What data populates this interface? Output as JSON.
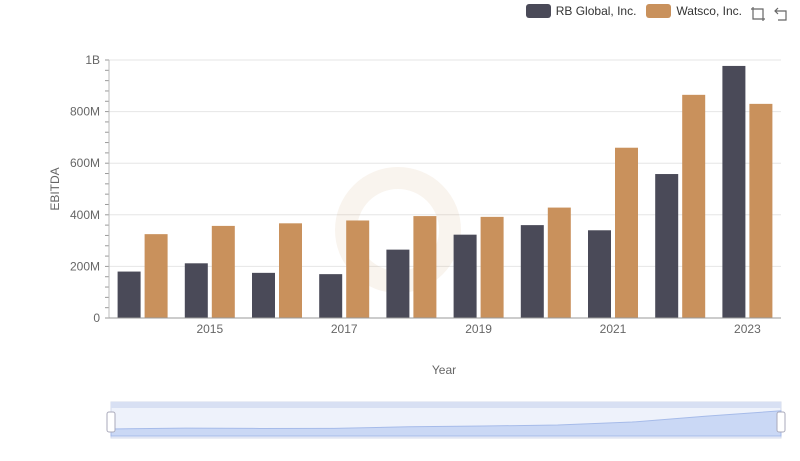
{
  "chart_data": {
    "type": "bar",
    "xlabel": "Year",
    "ylabel": "EBITDA",
    "x": [
      2014,
      2015,
      2016,
      2017,
      2018,
      2019,
      2020,
      2021,
      2022,
      2023
    ],
    "x_tick_labels": [
      "2015",
      "2017",
      "2019",
      "2021",
      "2023"
    ],
    "y_tick_labels": [
      "0",
      "200M",
      "400M",
      "600M",
      "800M",
      "1B"
    ],
    "ylim": [
      0,
      1000000000
    ],
    "grid": true,
    "legend_position": "top-right",
    "series": [
      {
        "name": "RB Global, Inc.",
        "color": "#4a4a58",
        "values": [
          180000000,
          212000000,
          175000000,
          170000000,
          265000000,
          323000000,
          360000000,
          340000000,
          558000000,
          977000000
        ]
      },
      {
        "name": "Watsco, Inc.",
        "color": "#c9915c",
        "values": [
          325000000,
          357000000,
          367000000,
          378000000,
          395000000,
          392000000,
          428000000,
          660000000,
          865000000,
          830000000
        ]
      }
    ]
  },
  "icons": {
    "zoom": "zoom-area-icon",
    "restore": "restore-icon"
  }
}
